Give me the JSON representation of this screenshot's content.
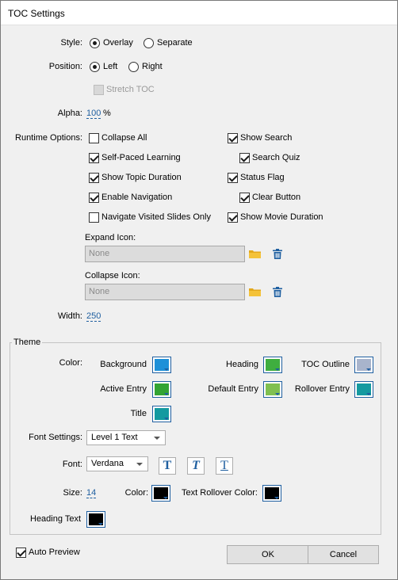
{
  "window": {
    "title": "TOC Settings"
  },
  "style": {
    "label": "Style:",
    "overlay": "Overlay",
    "separate": "Separate",
    "selected": "Overlay"
  },
  "position": {
    "label": "Position:",
    "left": "Left",
    "right": "Right",
    "selected": "Left"
  },
  "stretch_toc": {
    "label": "Stretch TOC",
    "checked": false,
    "enabled": false
  },
  "alpha": {
    "label": "Alpha:",
    "value": "100",
    "unit": "%"
  },
  "runtime": {
    "label": "Runtime Options:",
    "options": [
      {
        "label": "Collapse All",
        "checked": false
      },
      {
        "label": "Show Search",
        "checked": true
      },
      {
        "label": "Self-Paced Learning",
        "checked": true
      },
      {
        "label": "Search Quiz",
        "checked": true
      },
      {
        "label": "Show Topic Duration",
        "checked": true
      },
      {
        "label": "Status Flag",
        "checked": true
      },
      {
        "label": "Enable Navigation",
        "checked": true
      },
      {
        "label": "Clear Button",
        "checked": true
      },
      {
        "label": "Navigate Visited Slides Only",
        "checked": false
      },
      {
        "label": "Show Movie Duration",
        "checked": true
      }
    ]
  },
  "expand_icon": {
    "label": "Expand Icon:",
    "value": "None"
  },
  "collapse_icon": {
    "label": "Collapse Icon:",
    "value": "None"
  },
  "width": {
    "label": "Width:",
    "value": "250"
  },
  "theme": {
    "legend": "Theme",
    "color_label": "Color:",
    "colors": {
      "background": {
        "label": "Background",
        "hex": "#1e90d8"
      },
      "heading": {
        "label": "Heading",
        "hex": "#3fae3f"
      },
      "toc_outline": {
        "label": "TOC Outline",
        "hex": "#a8b4cc"
      },
      "active_entry": {
        "label": "Active Entry",
        "hex": "#33a433"
      },
      "default_entry": {
        "label": "Default Entry",
        "hex": "#80c050"
      },
      "rollover_entry": {
        "label": "Rollover Entry",
        "hex": "#149aa0"
      },
      "title": {
        "label": "Title",
        "hex": "#149aa0"
      }
    },
    "font_settings": {
      "label": "Font Settings:",
      "value": "Level 1 Text"
    },
    "font": {
      "label": "Font:",
      "value": "Verdana"
    },
    "style_buttons": {
      "bold": "T",
      "italic": "T",
      "underline": "T"
    },
    "size": {
      "label": "Size:",
      "value": "14"
    },
    "text_color": {
      "label": "Color:",
      "hex": "#000000"
    },
    "text_rollover_color": {
      "label": "Text Rollover Color:",
      "hex": "#000000"
    },
    "heading_text": {
      "label": "Heading Text",
      "hex": "#000000"
    }
  },
  "auto_preview": {
    "label": "Auto Preview",
    "checked": true
  },
  "buttons": {
    "ok": "OK",
    "cancel": "Cancel"
  },
  "icons": {
    "folder": "folder-icon",
    "trash": "trash-icon"
  },
  "accent": "#1f5fa0"
}
